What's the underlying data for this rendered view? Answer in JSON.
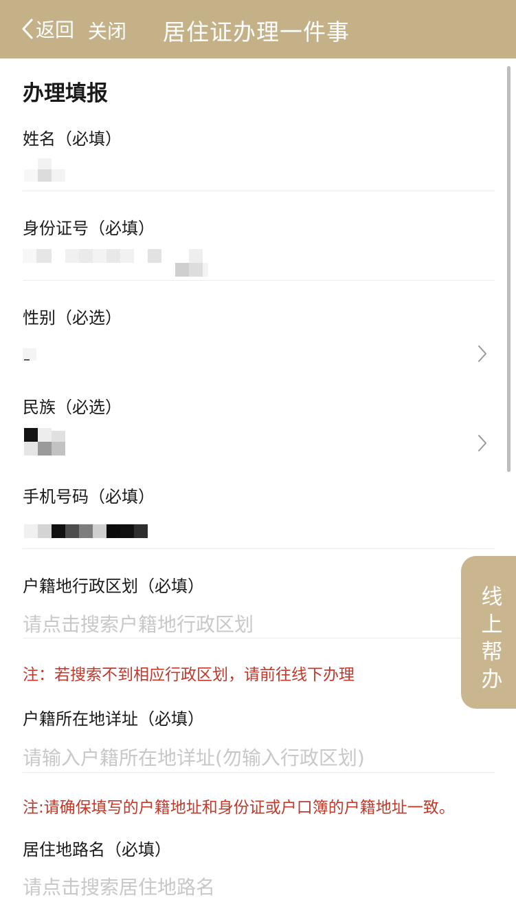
{
  "nav": {
    "back_label": "返回",
    "close_label": "关闭",
    "title": "居住证办理一件事"
  },
  "form": {
    "section_title": "办理填报",
    "name": {
      "label": "姓名（必填）"
    },
    "id_number": {
      "label": "身份证号（必填）"
    },
    "gender": {
      "label": "性别（必选）"
    },
    "ethnicity": {
      "label": "民族（必选）"
    },
    "phone": {
      "label": "手机号码（必填）"
    },
    "household_region": {
      "label": "户籍地行政区划（必填）",
      "placeholder": "请点击搜索户籍地行政区划",
      "note": "注：若搜索不到相应行政区划，请前往线下办理"
    },
    "household_address": {
      "label": "户籍所在地详址（必填）",
      "placeholder": "请输入户籍所在地详址(勿输入行政区划)",
      "note": "注:请确保填写的户籍地址和身份证或户口簿的户籍地址一致。"
    },
    "residence_road": {
      "label": "居住地路名（必填）",
      "placeholder": "请点击搜索居住地路名"
    }
  },
  "help_tab": {
    "label": "线上帮办"
  },
  "colors": {
    "header_bg": "#c4b187",
    "help_tab_bg": "#c9b68e",
    "note_red": "#c0392b",
    "placeholder_gray": "#c8c8c8"
  }
}
